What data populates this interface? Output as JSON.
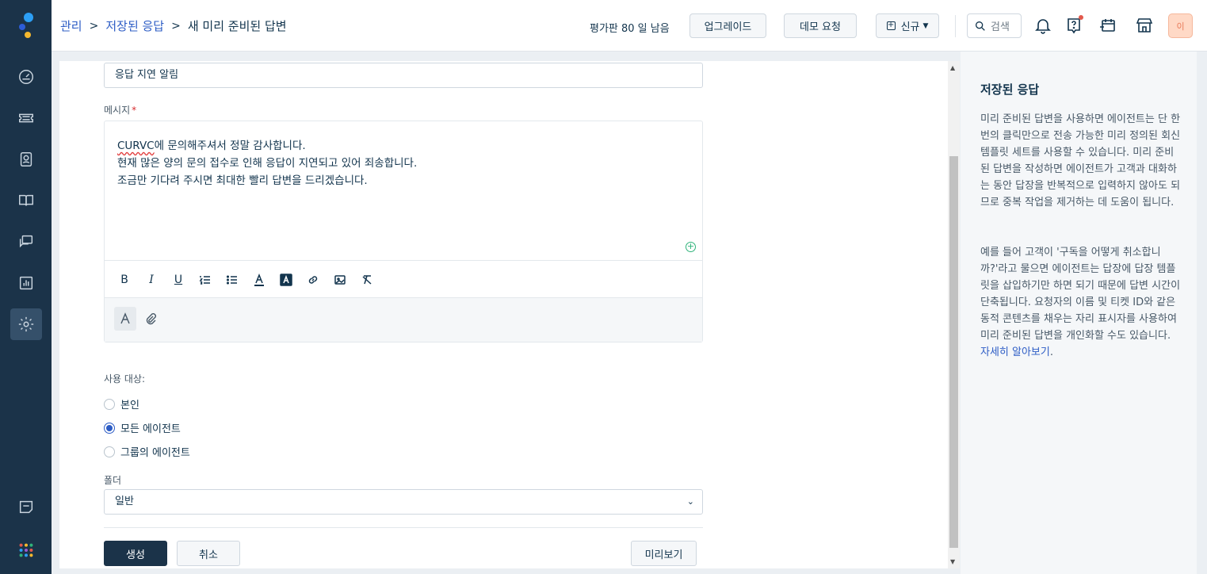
{
  "colors": {
    "sidebar_bg": "#1b3349",
    "primary": "#1b3349",
    "link": "#2c5cc5",
    "required": "#d72d30",
    "logo_blue": "#2c9ff5",
    "logo_yellow": "#f5b82e",
    "logo_navy": "#2d5dd7"
  },
  "sidebar": {
    "items": [
      {
        "name": "dashboard",
        "icon": "gauge-icon"
      },
      {
        "name": "tickets",
        "icon": "ticket-icon"
      },
      {
        "name": "contacts",
        "icon": "contact-icon"
      },
      {
        "name": "knowledge-base",
        "icon": "book-icon"
      },
      {
        "name": "conversations",
        "icon": "chat-icon"
      },
      {
        "name": "reports",
        "icon": "chart-icon"
      },
      {
        "name": "admin",
        "icon": "gear-icon"
      },
      {
        "name": "chat-widget",
        "icon": "message-icon"
      },
      {
        "name": "apps",
        "icon": "grid-dots-icon"
      }
    ]
  },
  "header": {
    "breadcrumb": [
      "관리",
      "저장된 응답",
      "새 미리 준비된 답변"
    ],
    "trial_text": "평가판 80 일 남음",
    "upgrade_label": "업그레이드",
    "demo_label": "데모 요청",
    "new_label": "신규",
    "search_placeholder": "검색",
    "avatar_initial": "이"
  },
  "form": {
    "title_value": "응답 지연 알림",
    "message_label": "메시지",
    "required_mark": "*",
    "message_brand": "CURVC",
    "message_line1_rest": "에 문의해주셔서 정말 감사합니다.",
    "message_line2": "현재 많은 양의 문의 접수로 인해 응답이 지연되고 있어 죄송합니다.",
    "message_line3": "조금만 기다려 주시면 최대한 빨리 답변을 드리겠습니다.",
    "toolbar": [
      "bold",
      "italic",
      "underline",
      "ordered-list",
      "bullet-list",
      "text-color",
      "highlight",
      "link",
      "image",
      "clear-format"
    ],
    "visibility_label": "사용 대상:",
    "visibility_options": [
      {
        "label": "본인",
        "checked": false
      },
      {
        "label": "모든 에이전트",
        "checked": true
      },
      {
        "label": "그룹의 에이전트",
        "checked": false
      }
    ],
    "folder_label": "폴더",
    "folder_value": "일반",
    "create_label": "생성",
    "cancel_label": "취소",
    "preview_label": "미리보기"
  },
  "right_panel": {
    "title": "저장된 응답",
    "para1": "미리 준비된 답변을 사용하면 에이전트는 단 한번의 클릭만으로 전송 가능한 미리 정의된 회신 템플릿 세트를 사용할 수 있습니다. 미리 준비된 답변을 작성하면 에이전트가 고객과 대화하는 동안 답장을 반복적으로 입력하지 않아도 되므로 중복 작업을 제거하는 데 도움이 됩니다.",
    "para2": "예를 들어 고객이 '구독을 어떻게 취소합니까?'라고 물으면 에이전트는 답장에 답장 템플릿을 삽입하기만 하면 되기 때문에 답변 시간이 단축됩니다. 요청자의 이름 및 티켓 ID와 같은 동적 콘텐츠를 채우는 자리 표시자를 사용하여 미리 준비된 답변을 개인화할 수도 있습니다.",
    "learn_more": "자세히 알아보기",
    "learn_more_suffix": "."
  }
}
